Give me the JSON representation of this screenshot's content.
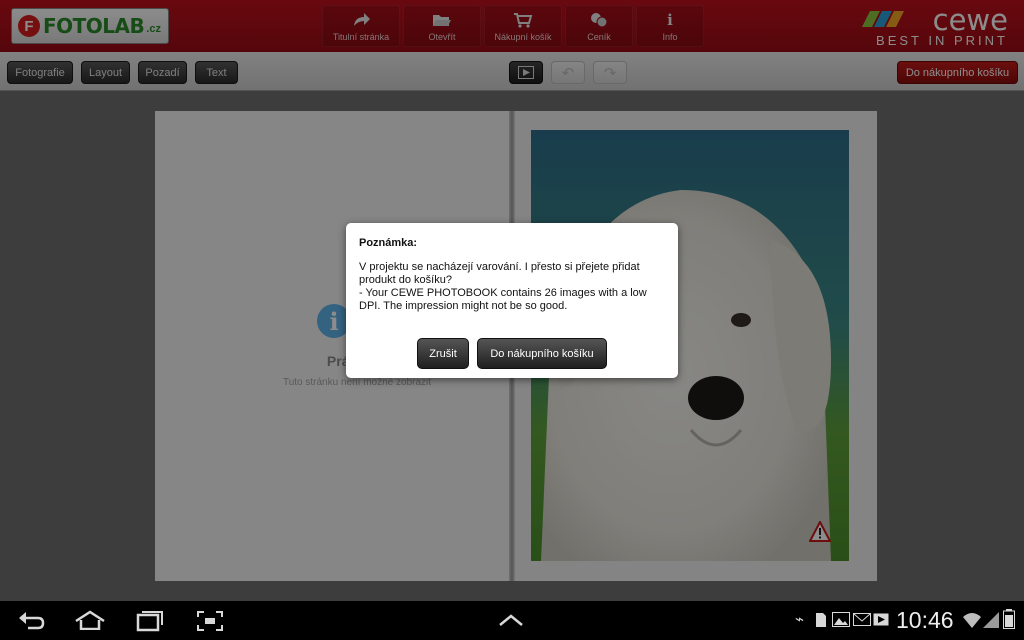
{
  "header": {
    "logo": {
      "mark": "F",
      "text": "FOTOLAB",
      "suffix": ".cz"
    },
    "nav": [
      {
        "label": "Titulní stránka",
        "icon": "home-arrow-icon"
      },
      {
        "label": "Otevřít",
        "icon": "open-folder-icon"
      },
      {
        "label": "Nákupní košík",
        "icon": "cart-icon"
      },
      {
        "label": "Ceník",
        "icon": "coins-icon"
      },
      {
        "label": "Info",
        "icon": "info-icon"
      }
    ],
    "brand": {
      "name": "cewe",
      "tagline": "BEST IN PRINT"
    }
  },
  "toolbar": {
    "tabs": [
      "Fotografie",
      "Layout",
      "Pozadí",
      "Text"
    ],
    "cart_label": "Do nákupního košíku"
  },
  "book": {
    "empty_title": "Prázdná s",
    "empty_sub": "Tuto stránku není možné zobrazit"
  },
  "dialog": {
    "title": "Poznámka:",
    "line1": "V projektu se nacházejí varování. I přesto si přejete přidat produkt do košíku?",
    "line2": "- Your CEWE PHOTOBOOK contains 26 images with a low DPI. The impression might not be so good.",
    "cancel": "Zrušit",
    "confirm": "Do nákupního košíku"
  },
  "system": {
    "time": "10:46"
  },
  "colors": {
    "brand_red": "#b0101a",
    "logo_green": "#2a8b2a",
    "info_blue": "#5fb3ec"
  }
}
